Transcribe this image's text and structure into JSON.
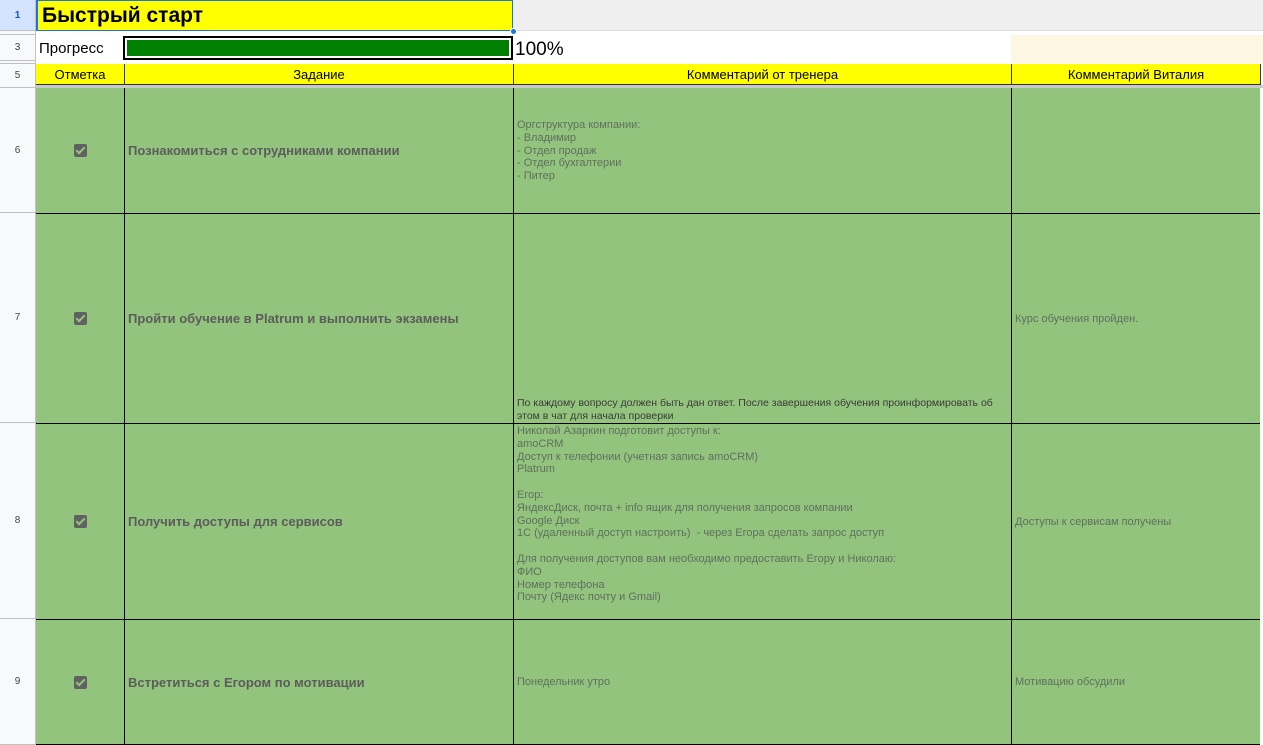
{
  "row_headers": [
    "1",
    "3",
    "5",
    "6",
    "7",
    "8",
    "9"
  ],
  "title": "Быстрый старт",
  "progress": {
    "label": "Прогресс",
    "value": 1.0,
    "text": "100%",
    "fill_color": "#008000"
  },
  "headers": {
    "mark": "Отметка",
    "task": "Задание",
    "trainer_comment": "Комментарий от тренера",
    "vitaly_comment": "Комментарий Виталия"
  },
  "colors": {
    "header_bg": "#ffff00",
    "row_bg": "#93c47d",
    "selection": "#1a73e8"
  },
  "rows": [
    {
      "num": "6",
      "checked": true,
      "task": "Познакомиться с сотрудниками компании",
      "trainer_comment": "Оргструктура компании:\n- Владимир\n- Отдел продаж\n- Отдел бухгалтерии\n- Питер",
      "vitaly_comment": ""
    },
    {
      "num": "7",
      "checked": true,
      "task": "Пройти обучение в Platrum и выполнить экзамены",
      "trainer_comment": "По каждому вопросу должен быть дан ответ. После завершения обучения проинформировать об\nэтом в чат для начала проверки",
      "vitaly_comment": "Курс обучения пройден."
    },
    {
      "num": "8",
      "checked": true,
      "task": "Получить доступы для сервисов",
      "trainer_comment": "Николай Азаркин подготовит доступы к:\namoCRM\nДоступ к телефонии (учетная запись amoCRM)\nPlatrum\n\nЕгор:\nЯндексДиск, почта + info ящик для получения запросов компании\nGoogle Диск\n1С (удаленный доступ настроить)  - через Егора сделать запрос доступ\n\nДля получения доступов вам необходимо предоставить Егору и Николаю:\nФИО\nНомер телефона\nПочту (Ядекс почту и Gmail)",
      "vitaly_comment": "Доступы к сервисам получены"
    },
    {
      "num": "9",
      "checked": true,
      "task": "Встретиться с Егором по мотивации",
      "trainer_comment": "Понедельник утро",
      "vitaly_comment": "Мотивацию обсудили"
    }
  ]
}
